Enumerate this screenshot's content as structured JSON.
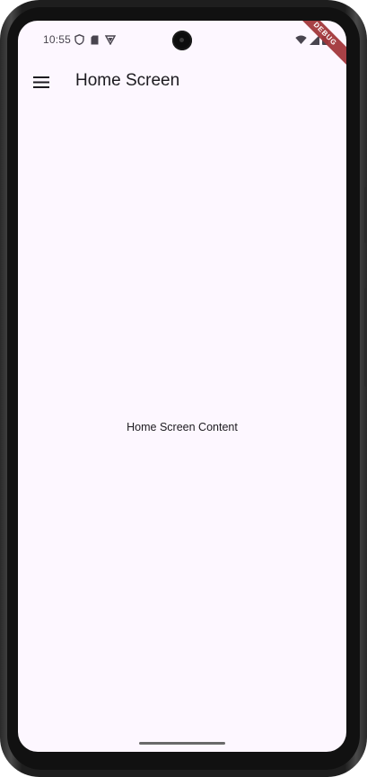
{
  "status_bar": {
    "time": "10:55",
    "left_icons": [
      "shield-icon",
      "sd-card-icon",
      "vpn-shield-icon"
    ],
    "right_icons": [
      "wifi-icon",
      "cellular-signal-icon",
      "battery-icon"
    ]
  },
  "debug_banner": {
    "label": "DEBUG",
    "color": "#a3373c"
  },
  "app_bar": {
    "title": "Home Screen",
    "menu_icon": "menu-icon"
  },
  "body": {
    "content_text": "Home Screen Content"
  },
  "colors": {
    "background": "#fdf7ff",
    "text": "#1d1b20"
  }
}
